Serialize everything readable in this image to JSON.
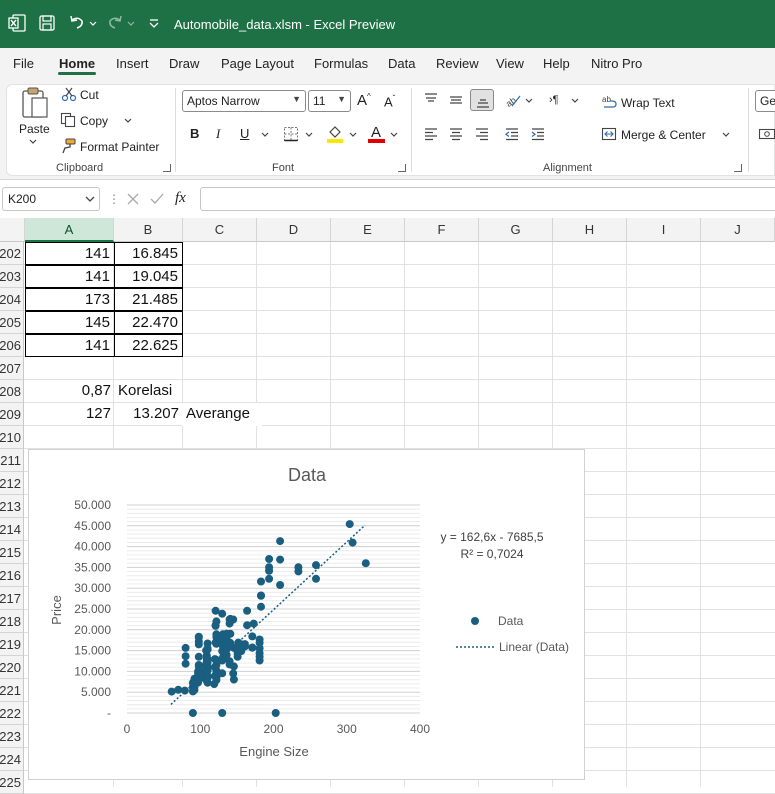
{
  "window": {
    "title": "Automobile_data.xlsm  -  Excel Preview"
  },
  "menu": {
    "items": [
      "File",
      "Home",
      "Insert",
      "Draw",
      "Page Layout",
      "Formulas",
      "Data",
      "Review",
      "View",
      "Help",
      "Nitro Pro"
    ],
    "active": "Home"
  },
  "ribbon": {
    "clipboard": {
      "paste": "Paste",
      "cut": "Cut",
      "copy": "Copy",
      "format_painter": "Format Painter",
      "label": "Clipboard"
    },
    "font": {
      "name": "Aptos Narrow",
      "size": "11",
      "label": "Font",
      "bold": "B",
      "italic": "I",
      "underline": "U",
      "font_color_letter": "A"
    },
    "alignment": {
      "wrap_text": "Wrap Text",
      "merge_center": "Merge & Center",
      "label": "Alignment"
    },
    "number": {
      "format_partial": "Gen"
    }
  },
  "formula_bar": {
    "name_box": "K200",
    "fx": "fx",
    "formula": ""
  },
  "sheet": {
    "columns": [
      "A",
      "B",
      "C",
      "D",
      "E",
      "F",
      "G",
      "H",
      "I",
      "J"
    ],
    "selected_column": "A",
    "rows": [
      "202",
      "203",
      "204",
      "205",
      "206",
      "207",
      "208",
      "209",
      "210",
      "211",
      "212",
      "213",
      "214",
      "215",
      "216",
      "217",
      "218",
      "219",
      "220",
      "221",
      "222",
      "223",
      "224",
      "225"
    ],
    "cells": {
      "r202": {
        "a": "141",
        "b": "16.845"
      },
      "r203": {
        "a": "141",
        "b": "19.045"
      },
      "r204": {
        "a": "173",
        "b": "21.485"
      },
      "r205": {
        "a": "145",
        "b": "22.470"
      },
      "r206": {
        "a": "141",
        "b": "22.625"
      },
      "r208": {
        "a": "0,87",
        "b": "Korelasi"
      },
      "r209": {
        "a": "127",
        "b": "13.207",
        "c": "Averange"
      }
    }
  },
  "chart_data": {
    "type": "scatter",
    "title": "Data",
    "xlabel": "Engine Size",
    "ylabel": "Price",
    "xlim": [
      0,
      400
    ],
    "ylim": [
      0,
      50000
    ],
    "x_ticks": [
      "0",
      "100",
      "200",
      "300",
      "400"
    ],
    "y_ticks": [
      "-",
      "5.000",
      "10.000",
      "15.000",
      "20.000",
      "25.000",
      "30.000",
      "35.000",
      "40.000",
      "45.000",
      "50.000"
    ],
    "grid": "horizontal",
    "legend_position": "right",
    "legend": [
      "Data",
      "Linear (Data)"
    ],
    "trendline": {
      "slope": 162.6,
      "intercept": -7685.5,
      "equation": "y = 162,6x - 7685,5",
      "r2_label": "R² = 0,7024"
    },
    "colors": {
      "points": "#1a5e80",
      "trend": "#1a5e80"
    },
    "series": [
      {
        "name": "Data",
        "points": [
          [
            61,
            5151
          ],
          [
            70,
            5572
          ],
          [
            79,
            5389
          ],
          [
            80,
            11845
          ],
          [
            80,
            13645
          ],
          [
            80,
            15645
          ],
          [
            90,
            5195
          ],
          [
            90,
            6095
          ],
          [
            90,
            6229
          ],
          [
            90,
            7295
          ],
          [
            90,
            0
          ],
          [
            92,
            5499
          ],
          [
            92,
            6189
          ],
          [
            92,
            6669
          ],
          [
            92,
            6855
          ],
          [
            92,
            7129
          ],
          [
            92,
            7349
          ],
          [
            92,
            8249
          ],
          [
            97,
            7299
          ],
          [
            97,
            7775
          ],
          [
            97,
            7975
          ],
          [
            97,
            7995
          ],
          [
            97,
            8195
          ],
          [
            97,
            8495
          ],
          [
            97,
            9495
          ],
          [
            97,
            9995
          ],
          [
            98,
            8778
          ],
          [
            98,
            9279
          ],
          [
            98,
            11549
          ],
          [
            98,
            10198
          ],
          [
            98,
            8058
          ],
          [
            98,
            9639
          ],
          [
            98,
            11199
          ],
          [
            98,
            13499
          ],
          [
            98,
            16500
          ],
          [
            98,
            17199
          ],
          [
            98,
            18150
          ],
          [
            98,
            18344
          ],
          [
            103,
            9095
          ],
          [
            108,
            9960
          ],
          [
            108,
            8013
          ],
          [
            108,
            10345
          ],
          [
            108,
            9233
          ],
          [
            108,
            11259
          ],
          [
            108,
            11694
          ],
          [
            108,
            15040
          ],
          [
            109,
            7775
          ],
          [
            109,
            7975
          ],
          [
            109,
            8195
          ],
          [
            109,
            8495
          ],
          [
            109,
            9495
          ],
          [
            109,
            9995
          ],
          [
            109,
            11595
          ],
          [
            109,
            9980
          ],
          [
            109,
            12290
          ],
          [
            109,
            12945
          ],
          [
            109,
            13845
          ],
          [
            109,
            12295
          ],
          [
            109,
            13295
          ],
          [
            110,
            7295
          ],
          [
            110,
            8845
          ],
          [
            110,
            8495
          ],
          [
            110,
            10295
          ],
          [
            110,
            12945
          ],
          [
            110,
            10345
          ],
          [
            110,
            11048
          ],
          [
            110,
            12170
          ],
          [
            110,
            15250
          ],
          [
            110,
            15510
          ],
          [
            110,
            16695
          ],
          [
            119,
            6938
          ],
          [
            120,
            8921
          ],
          [
            120,
            11048
          ],
          [
            120,
            12964
          ],
          [
            121,
            16925
          ],
          [
            121,
            20970
          ],
          [
            121,
            21105
          ],
          [
            121,
            24565
          ],
          [
            122,
            7898
          ],
          [
            122,
            8449
          ],
          [
            122,
            8948
          ],
          [
            122,
            9538
          ],
          [
            122,
            10198
          ],
          [
            122,
            11549
          ],
          [
            122,
            12764
          ],
          [
            122,
            16630
          ],
          [
            122,
            17075
          ],
          [
            122,
            18280
          ],
          [
            122,
            18920
          ],
          [
            122,
            22018
          ],
          [
            130,
            9549
          ],
          [
            130,
            12629
          ],
          [
            130,
            14869
          ],
          [
            130,
            17710
          ],
          [
            130,
            23875
          ],
          [
            130,
            0
          ],
          [
            131,
            13415
          ],
          [
            131,
            15985
          ],
          [
            131,
            16515
          ],
          [
            131,
            18420
          ],
          [
            131,
            18950
          ],
          [
            134,
            15580
          ],
          [
            134,
            16900
          ],
          [
            134,
            17669
          ],
          [
            134,
            18150
          ],
          [
            134,
            18344
          ],
          [
            136,
            13950
          ],
          [
            136,
            15250
          ],
          [
            136,
            17450
          ],
          [
            136,
            17859
          ],
          [
            136,
            19045
          ],
          [
            140,
            12440
          ],
          [
            140,
            11694
          ],
          [
            140,
            16500
          ],
          [
            140,
            21485
          ],
          [
            140,
            22470
          ],
          [
            141,
            16845
          ],
          [
            141,
            19045
          ],
          [
            141,
            22625
          ],
          [
            145,
            22470
          ],
          [
            145,
            9495
          ],
          [
            146,
            11199
          ],
          [
            146,
            8058
          ],
          [
            146,
            15645
          ],
          [
            151,
            14399
          ],
          [
            151,
            13499
          ],
          [
            152,
            15750
          ],
          [
            152,
            16430
          ],
          [
            152,
            16925
          ],
          [
            156,
            14869
          ],
          [
            156,
            16500
          ],
          [
            161,
            15998
          ],
          [
            161,
            16558
          ],
          [
            164,
            21105
          ],
          [
            164,
            24565
          ],
          [
            171,
            15690
          ],
          [
            171,
            15750
          ],
          [
            171,
            18420
          ],
          [
            173,
            21485
          ],
          [
            181,
            14399
          ],
          [
            181,
            12629
          ],
          [
            181,
            13499
          ],
          [
            181,
            15580
          ],
          [
            181,
            16900
          ],
          [
            181,
            17669
          ],
          [
            183,
            25552
          ],
          [
            183,
            28248
          ],
          [
            183,
            31600
          ],
          [
            183,
            28176
          ],
          [
            194,
            32250
          ],
          [
            194,
            34184
          ],
          [
            194,
            37028
          ],
          [
            194,
            35056
          ],
          [
            203,
            0
          ],
          [
            209,
            30760
          ],
          [
            209,
            41315
          ],
          [
            209,
            36880
          ],
          [
            234,
            34028
          ],
          [
            234,
            35056
          ],
          [
            258,
            32250
          ],
          [
            258,
            35550
          ],
          [
            304,
            45400
          ],
          [
            308,
            40960
          ],
          [
            326,
            36000
          ]
        ]
      }
    ]
  }
}
